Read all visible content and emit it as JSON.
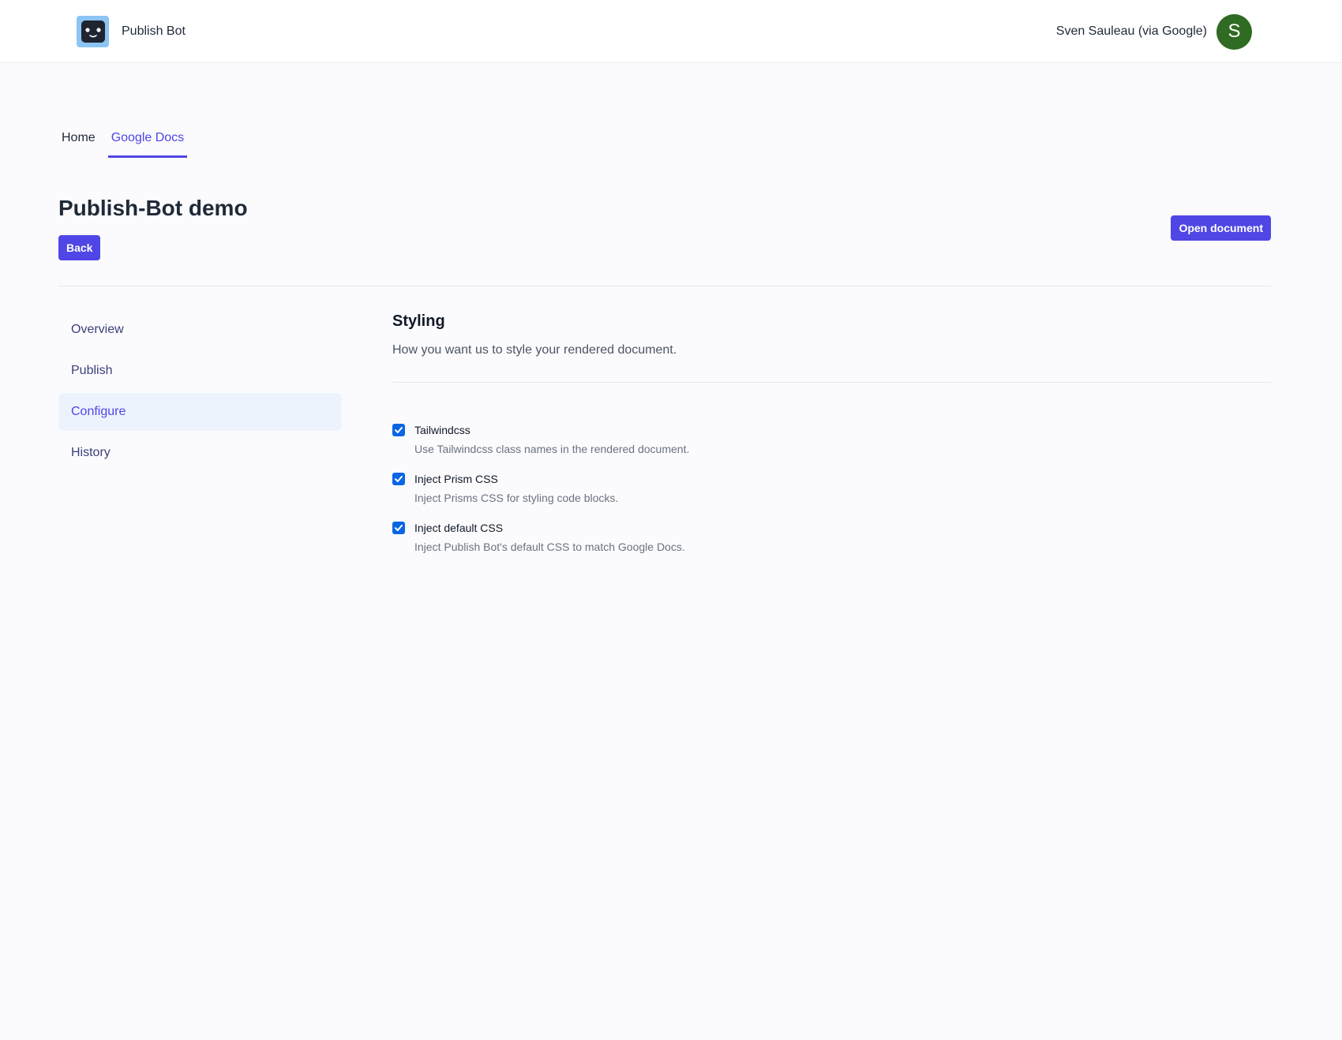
{
  "app": {
    "name": "Publish Bot"
  },
  "user": {
    "name": "Sven Sauleau (via Google)",
    "initial": "S"
  },
  "tabs": [
    {
      "label": "Home",
      "active": false
    },
    {
      "label": "Google Docs",
      "active": true
    }
  ],
  "page": {
    "title": "Publish-Bot demo",
    "back_label": "Back",
    "open_label": "Open document"
  },
  "sidebar": {
    "items": [
      {
        "label": "Overview",
        "active": false
      },
      {
        "label": "Publish",
        "active": false
      },
      {
        "label": "Configure",
        "active": true
      },
      {
        "label": "History",
        "active": false
      }
    ]
  },
  "styling": {
    "title": "Styling",
    "description": "How you want us to style your rendered document.",
    "options": [
      {
        "label": "Tailwindcss",
        "help": "Use Tailwindcss class names in the rendered document.",
        "checked": true
      },
      {
        "label": "Inject Prism CSS",
        "help": "Inject Prisms CSS for styling code blocks.",
        "checked": true
      },
      {
        "label": "Inject default CSS",
        "help": "Inject Publish Bot's default CSS to match Google Docs.",
        "checked": true
      }
    ]
  },
  "colors": {
    "accent": "#4f46e5",
    "checkbox": "#0b66e4",
    "avatar": "#2f6b22",
    "logo_bg": "#8cc4f3"
  }
}
